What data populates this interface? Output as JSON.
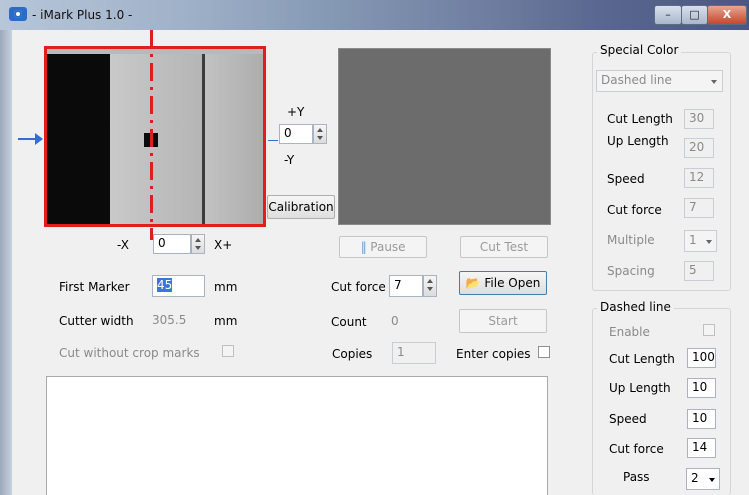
{
  "window": {
    "title": "- iMark Plus 1.0 -",
    "min": "–",
    "max": "□",
    "close": "X"
  },
  "camera": {
    "plus_y": "+Y",
    "minus_y": "-Y",
    "y_value": "0",
    "minus_x": "-X",
    "plus_x": "X+",
    "x_value": "0",
    "calibration_label": "Calibration"
  },
  "controls": {
    "pause_label": "Pause",
    "cut_test_label": "Cut Test",
    "file_open_label": "File Open",
    "start_label": "Start",
    "first_marker_label": "First Marker",
    "first_marker_value": "45",
    "first_marker_unit": "mm",
    "cutter_width_label": "Cutter width",
    "cutter_width_value": "305.5",
    "cutter_width_unit": "mm",
    "cut_without_crop_label": "Cut without crop marks",
    "cut_force_label": "Cut force",
    "cut_force_value": "7",
    "count_label": "Count",
    "count_value": "0",
    "copies_label": "Copies",
    "copies_value": "1",
    "enter_copies_label": "Enter copies"
  },
  "special_color": {
    "title": "Special Color",
    "mode": "Dashed line",
    "cut_length_label": "Cut Length",
    "cut_length": "30",
    "up_length_label": "Up Length",
    "up_length": "20",
    "speed_label": "Speed",
    "speed": "12",
    "cut_force_label": "Cut force",
    "cut_force": "7",
    "multiple_label": "Multiple",
    "multiple": "1",
    "spacing_label": "Spacing",
    "spacing": "5"
  },
  "dashed_line": {
    "title": "Dashed line",
    "enable_label": "Enable",
    "cut_length_label": "Cut Length",
    "cut_length": "100",
    "up_length_label": "Up Length",
    "up_length": "10",
    "speed_label": "Speed",
    "speed": "10",
    "cut_force_label": "Cut force",
    "cut_force": "14",
    "pass_label": "Pass",
    "pass": "2"
  },
  "colors": {
    "marker_frame": "#e11d1d",
    "arrow": "#2f6fd6",
    "preview_bg": "#6c6c6c"
  }
}
